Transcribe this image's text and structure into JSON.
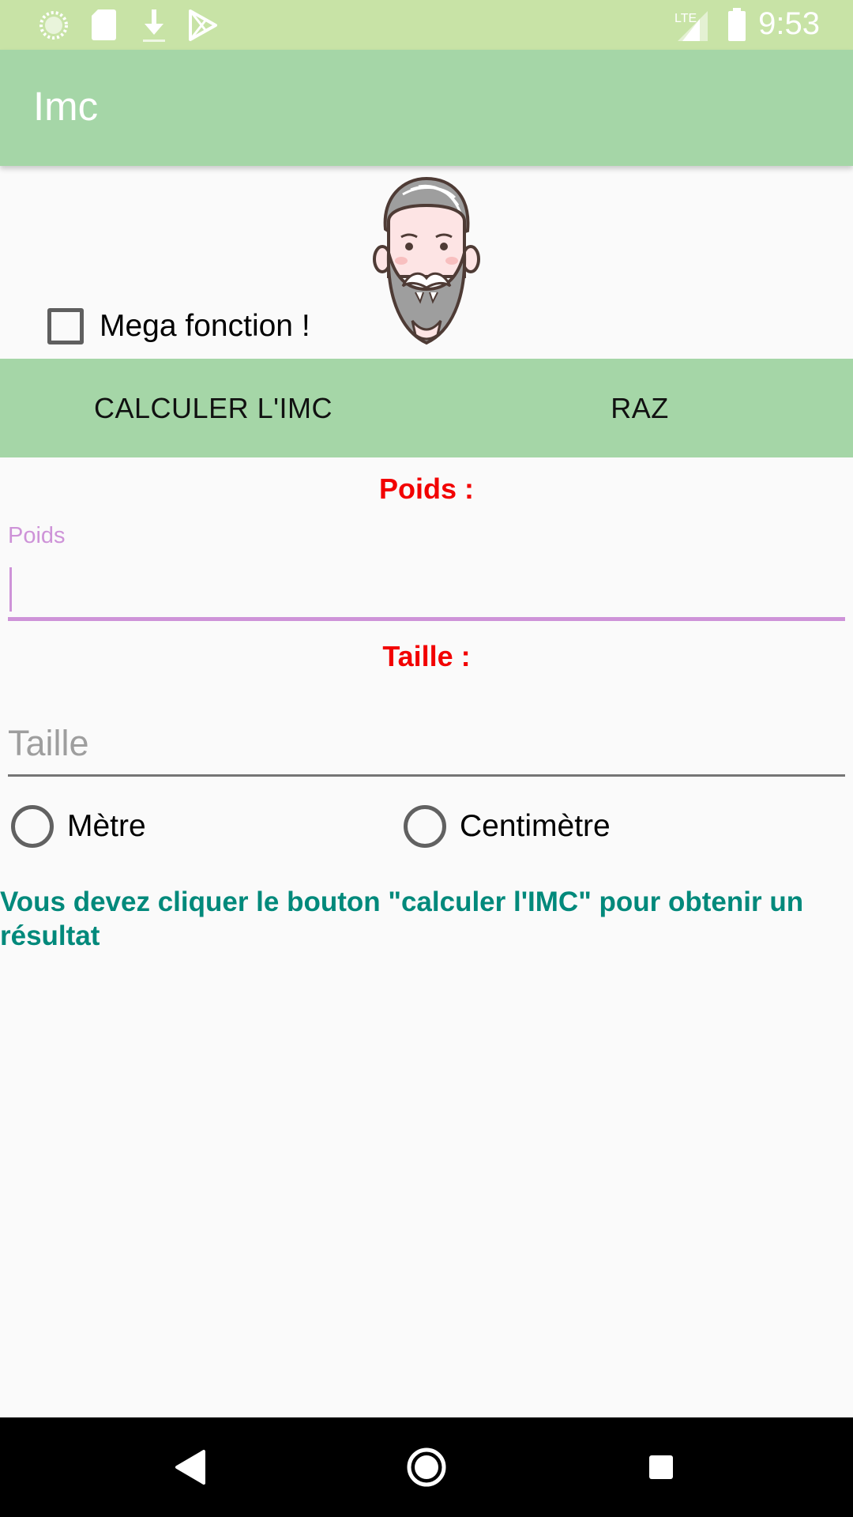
{
  "status_bar": {
    "time": "9:53",
    "network": "LTE",
    "icons": [
      "sync-icon",
      "sd-card-icon",
      "download-icon",
      "play-store-icon",
      "lte-signal-icon",
      "battery-icon"
    ]
  },
  "app_bar": {
    "title": "Imc"
  },
  "avatar": {
    "icon": "bearded-man-avatar"
  },
  "mega_checkbox": {
    "label": "Mega fonction !",
    "checked": false
  },
  "buttons": {
    "calculate": "CALCULER L'IMC",
    "reset": "RAZ"
  },
  "weight": {
    "section_label": "Poids :",
    "floating_label": "Poids",
    "value": ""
  },
  "height": {
    "section_label": "Taille :",
    "placeholder": "Taille",
    "value": ""
  },
  "units": {
    "meter": "Mètre",
    "centimeter": "Centimètre",
    "selected": null
  },
  "result": {
    "message": "Vous devez cliquer le bouton \"calculer l'IMC\" pour obtenir un résultat"
  },
  "colors": {
    "status_bar": "#c8e3a6",
    "app_bar": "#a5d6a7",
    "section_label": "#f20000",
    "input_focus": "#ce93d8",
    "result": "#00897b"
  },
  "nav_bar": {
    "icons": [
      "back-icon",
      "home-icon",
      "recents-icon"
    ]
  }
}
